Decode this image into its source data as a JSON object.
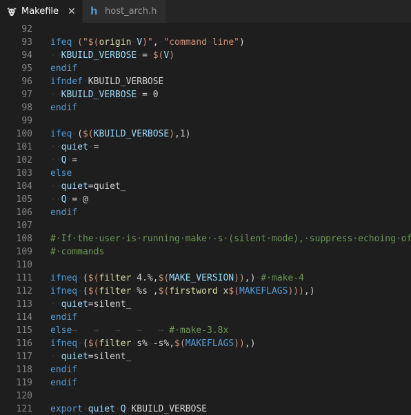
{
  "tabs": [
    {
      "label": "Makefile",
      "icon": "gnu-icon",
      "active": true,
      "close_glyph": "✕"
    },
    {
      "label": "host_arch.h",
      "icon": "h-file-icon",
      "icon_glyph": "h",
      "active": false
    }
  ],
  "colors": {
    "editor_background": "#1e1e1e",
    "tab_bar_background": "#252526",
    "line_number": "#858585",
    "keyword": "#569cd6",
    "function": "#dcdcaa",
    "string": "#ce9178",
    "number": "#b5cea8",
    "variable": "#9cdcfe",
    "comment": "#6a9955",
    "whitespace_marker": "#3b3b3b",
    "h_file_icon": "#4d92c9"
  },
  "editor": {
    "lines": [
      {
        "num": "92",
        "tokens": []
      },
      {
        "num": "93",
        "tokens": [
          {
            "t": "ifeq",
            "c": "kw"
          },
          {
            "t": "·",
            "c": "ws"
          },
          {
            "t": "(\"",
            "c": "str"
          },
          {
            "t": "$(",
            "c": "str"
          },
          {
            "t": "origin",
            "c": "fn"
          },
          {
            "t": "·",
            "c": "ws"
          },
          {
            "t": "V",
            "c": "var"
          },
          {
            "t": ")\"",
            "c": "str"
          },
          {
            "t": ",",
            "c": "op"
          },
          {
            "t": "·",
            "c": "ws"
          },
          {
            "t": "\"command",
            "c": "str"
          },
          {
            "t": "·",
            "c": "ws"
          },
          {
            "t": "line\"",
            "c": "str"
          },
          {
            "t": ")",
            "c": "op"
          }
        ]
      },
      {
        "num": "94",
        "tokens": [
          {
            "t": "··",
            "c": "ws"
          },
          {
            "t": "KBUILD_VERBOSE",
            "c": "var"
          },
          {
            "t": "·",
            "c": "ws"
          },
          {
            "t": "=",
            "c": "op"
          },
          {
            "t": "·",
            "c": "ws"
          },
          {
            "t": "$(",
            "c": "str"
          },
          {
            "t": "V",
            "c": "var"
          },
          {
            "t": ")",
            "c": "str"
          }
        ]
      },
      {
        "num": "95",
        "tokens": [
          {
            "t": "endif",
            "c": "kw"
          }
        ]
      },
      {
        "num": "96",
        "tokens": [
          {
            "t": "ifndef",
            "c": "kw"
          },
          {
            "t": "·",
            "c": "ws"
          },
          {
            "t": "KBUILD_VERBOSE",
            "c": "op"
          }
        ]
      },
      {
        "num": "97",
        "tokens": [
          {
            "t": "··",
            "c": "ws"
          },
          {
            "t": "KBUILD_VERBOSE",
            "c": "var"
          },
          {
            "t": "·",
            "c": "ws"
          },
          {
            "t": "=",
            "c": "op"
          },
          {
            "t": "·",
            "c": "ws"
          },
          {
            "t": "0",
            "c": "op"
          }
        ]
      },
      {
        "num": "98",
        "tokens": [
          {
            "t": "endif",
            "c": "kw"
          }
        ]
      },
      {
        "num": "99",
        "tokens": []
      },
      {
        "num": "100",
        "tokens": [
          {
            "t": "ifeq",
            "c": "kw"
          },
          {
            "t": "·",
            "c": "ws"
          },
          {
            "t": "(",
            "c": "op"
          },
          {
            "t": "$(",
            "c": "str"
          },
          {
            "t": "KBUILD_VERBOSE",
            "c": "var"
          },
          {
            "t": ")",
            "c": "str"
          },
          {
            "t": ",1)",
            "c": "op"
          }
        ]
      },
      {
        "num": "101",
        "tokens": [
          {
            "t": "··",
            "c": "ws"
          },
          {
            "t": "quiet",
            "c": "var"
          },
          {
            "t": "·",
            "c": "ws"
          },
          {
            "t": "=",
            "c": "op"
          }
        ]
      },
      {
        "num": "102",
        "tokens": [
          {
            "t": "··",
            "c": "ws"
          },
          {
            "t": "Q",
            "c": "var"
          },
          {
            "t": "·",
            "c": "ws"
          },
          {
            "t": "=",
            "c": "op"
          }
        ]
      },
      {
        "num": "103",
        "tokens": [
          {
            "t": "else",
            "c": "kw"
          }
        ]
      },
      {
        "num": "104",
        "tokens": [
          {
            "t": "··",
            "c": "ws"
          },
          {
            "t": "quiet",
            "c": "var"
          },
          {
            "t": "=quiet_",
            "c": "op"
          }
        ]
      },
      {
        "num": "105",
        "tokens": [
          {
            "t": "··",
            "c": "ws"
          },
          {
            "t": "Q",
            "c": "var"
          },
          {
            "t": "·",
            "c": "ws"
          },
          {
            "t": "=",
            "c": "op"
          },
          {
            "t": "·",
            "c": "ws"
          },
          {
            "t": "@",
            "c": "op"
          }
        ]
      },
      {
        "num": "106",
        "tokens": [
          {
            "t": "endif",
            "c": "kw"
          }
        ]
      },
      {
        "num": "107",
        "tokens": []
      },
      {
        "num": "108",
        "tokens": [
          {
            "t": "#·If·the·user·is·running·make·-s·(silent·mode),·suppress·echoing·of",
            "c": "cmt"
          }
        ]
      },
      {
        "num": "109",
        "tokens": [
          {
            "t": "#·commands",
            "c": "cmt"
          }
        ]
      },
      {
        "num": "110",
        "tokens": []
      },
      {
        "num": "111",
        "tokens": [
          {
            "t": "ifneq",
            "c": "kw"
          },
          {
            "t": "·",
            "c": "ws"
          },
          {
            "t": "(",
            "c": "op"
          },
          {
            "t": "$(",
            "c": "str"
          },
          {
            "t": "filter",
            "c": "fn"
          },
          {
            "t": "·",
            "c": "ws"
          },
          {
            "t": "4.%,",
            "c": "op"
          },
          {
            "t": "$(",
            "c": "str"
          },
          {
            "t": "MAKE_VERSION",
            "c": "var"
          },
          {
            "t": "))",
            "c": "str"
          },
          {
            "t": ",)",
            "c": "op"
          },
          {
            "t": "·",
            "c": "ws"
          },
          {
            "t": "#·make-4",
            "c": "cmt"
          }
        ]
      },
      {
        "num": "112",
        "tokens": [
          {
            "t": "ifneq",
            "c": "kw"
          },
          {
            "t": "·",
            "c": "ws"
          },
          {
            "t": "(",
            "c": "op"
          },
          {
            "t": "$(",
            "c": "str"
          },
          {
            "t": "filter",
            "c": "fn"
          },
          {
            "t": "·",
            "c": "ws"
          },
          {
            "t": "%s",
            "c": "op"
          },
          {
            "t": "·",
            "c": "ws"
          },
          {
            "t": ",",
            "c": "op"
          },
          {
            "t": "$(",
            "c": "str"
          },
          {
            "t": "firstword",
            "c": "fn"
          },
          {
            "t": "·",
            "c": "ws"
          },
          {
            "t": "x",
            "c": "op"
          },
          {
            "t": "$(",
            "c": "str"
          },
          {
            "t": "MAKEFLAGS",
            "c": "kw"
          },
          {
            "t": ")))",
            "c": "str"
          },
          {
            "t": ",)",
            "c": "op"
          }
        ]
      },
      {
        "num": "113",
        "tokens": [
          {
            "t": "··",
            "c": "ws"
          },
          {
            "t": "quiet",
            "c": "var"
          },
          {
            "t": "=silent_",
            "c": "op"
          }
        ]
      },
      {
        "num": "114",
        "tokens": [
          {
            "t": "endif",
            "c": "kw"
          }
        ]
      },
      {
        "num": "115",
        "tokens": [
          {
            "t": "else",
            "c": "kw"
          },
          {
            "t": "→   →   →   →   → ",
            "c": "ws"
          },
          {
            "t": "#·make-3.8x",
            "c": "cmt"
          }
        ]
      },
      {
        "num": "116",
        "tokens": [
          {
            "t": "ifneq",
            "c": "kw"
          },
          {
            "t": "·",
            "c": "ws"
          },
          {
            "t": "(",
            "c": "op"
          },
          {
            "t": "$(",
            "c": "str"
          },
          {
            "t": "filter",
            "c": "fn"
          },
          {
            "t": "·",
            "c": "ws"
          },
          {
            "t": "s%",
            "c": "op"
          },
          {
            "t": "·",
            "c": "ws"
          },
          {
            "t": "-s%,",
            "c": "op"
          },
          {
            "t": "$(",
            "c": "str"
          },
          {
            "t": "MAKEFLAGS",
            "c": "kw"
          },
          {
            "t": "))",
            "c": "str"
          },
          {
            "t": ",)",
            "c": "op"
          }
        ]
      },
      {
        "num": "117",
        "tokens": [
          {
            "t": "··",
            "c": "ws"
          },
          {
            "t": "quiet",
            "c": "var"
          },
          {
            "t": "=silent_",
            "c": "op"
          }
        ]
      },
      {
        "num": "118",
        "tokens": [
          {
            "t": "endif",
            "c": "kw"
          }
        ]
      },
      {
        "num": "119",
        "tokens": [
          {
            "t": "endif",
            "c": "kw"
          }
        ]
      },
      {
        "num": "120",
        "tokens": []
      },
      {
        "num": "121",
        "tokens": [
          {
            "t": "export",
            "c": "kw"
          },
          {
            "t": "·",
            "c": "ws"
          },
          {
            "t": "quiet",
            "c": "var"
          },
          {
            "t": "·",
            "c": "ws"
          },
          {
            "t": "Q",
            "c": "var"
          },
          {
            "t": "·",
            "c": "ws"
          },
          {
            "t": "KBUILD_VERBOSE",
            "c": "op"
          }
        ]
      }
    ]
  }
}
